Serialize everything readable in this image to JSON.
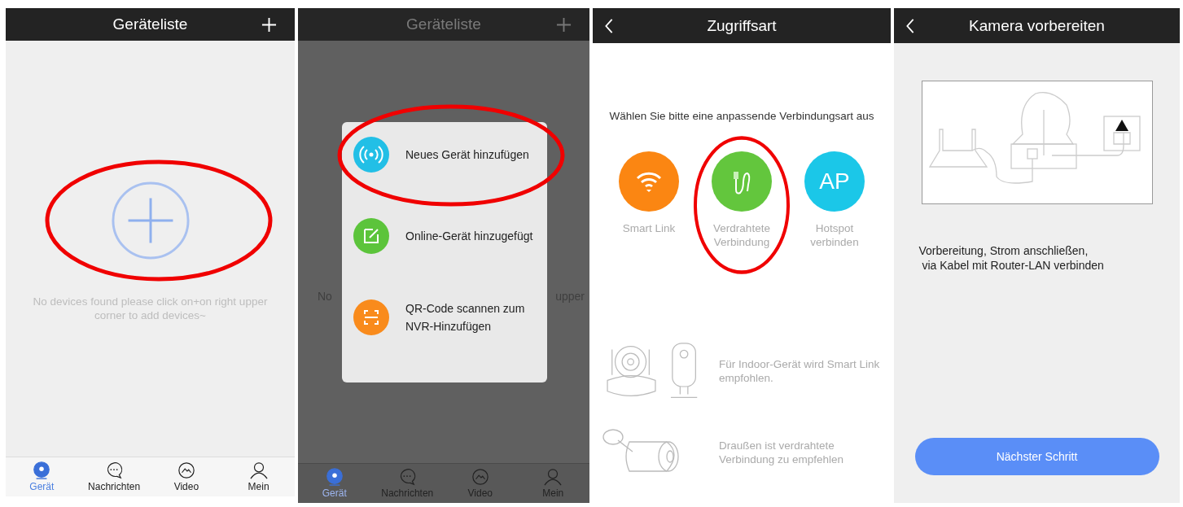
{
  "screens": [
    {
      "kind": "device_list",
      "dimmed": false,
      "title": "Geräteliste",
      "add_highlighted": true,
      "empty_text": "No devices found please click on+on right upper corner to add devices~",
      "tabs": [
        {
          "label": "Gerät",
          "selected": true
        },
        {
          "label": "Nachrichten",
          "selected": false
        },
        {
          "label": "Video",
          "selected": false
        },
        {
          "label": "Mein",
          "selected": false
        }
      ]
    },
    {
      "kind": "add_menu",
      "dimmed": true,
      "title": "Geräteliste",
      "background_text": [
        "No",
        "upper"
      ],
      "menu": [
        {
          "label": "Neues Gerät hinzufügen",
          "color": "#22bfe6",
          "highlighted": true
        },
        {
          "label": "Online-Gerät hinzugefügt",
          "color": "#5cc43b",
          "highlighted": false
        },
        {
          "label": "QR-Code scannen zum NVR-Hinzufügen",
          "color": "#f98b1c",
          "highlighted": false
        }
      ],
      "tabs": [
        {
          "label": "Gerät",
          "selected": true
        },
        {
          "label": "Nachrichten",
          "selected": false
        },
        {
          "label": "Video",
          "selected": false
        },
        {
          "label": "Mein",
          "selected": false
        }
      ]
    },
    {
      "kind": "access_type",
      "title": "Zugriffsart",
      "prompt": "Wählen Sie bitte eine anpassende Verbindungsart aus",
      "options": [
        {
          "label": "Smart Link",
          "color": "#fb8612",
          "highlighted": false
        },
        {
          "label": "Verdrahtete Verbindung",
          "color": "#63c63d",
          "highlighted": true
        },
        {
          "label": "Hotspot verbinden",
          "color": "#1bc7e8",
          "icon_text": "AP",
          "highlighted": false
        }
      ],
      "hints": [
        "Für Indoor-Gerät wird Smart Link empfohlen.",
        "Draußen ist verdrahtete Verbindung zu empfehlen"
      ]
    },
    {
      "kind": "prepare_camera",
      "title": "Kamera vorbereiten",
      "instruction": [
        "Vorbereitung, Strom anschließen,",
        "via Kabel mit Router-LAN verbinden"
      ],
      "button": "Nächster Schritt"
    }
  ]
}
